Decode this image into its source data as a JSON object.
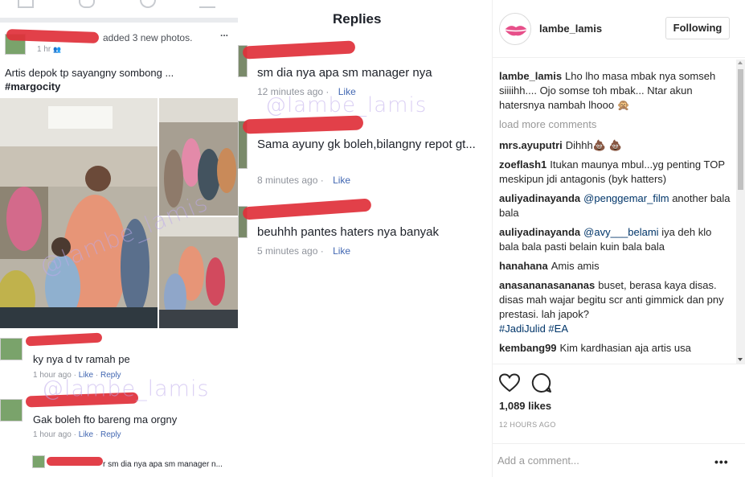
{
  "left": {
    "post_header": "added 3 new photos.",
    "post_meta": "1 hr",
    "post_text": "Artis depok tp sayangny sombong ...",
    "post_hashtag": "#margocity",
    "more_glyph": "...",
    "watermark": "@lambe_lamis",
    "comments": [
      {
        "text": "ky nya d tv ramah pe",
        "time": "1 hour ago",
        "like": "Like",
        "reply": "Reply"
      },
      {
        "text": "Gak boleh fto bareng ma orgny",
        "time": "1 hour ago",
        "like": "Like",
        "reply": "Reply"
      },
      {
        "text": "r sm dia nya apa sm manager n..."
      }
    ]
  },
  "middle": {
    "title": "Replies",
    "watermark": "@lambe_lamis",
    "replies": [
      {
        "text": "sm dia nya apa sm manager nya",
        "time": "12 minutes ago",
        "like": "Like"
      },
      {
        "text": "Sama ayuny gk boleh,bilangny repot gt...",
        "time": "8 minutes ago",
        "like": "Like"
      },
      {
        "text": "beuhhh pantes haters nya banyak",
        "time": "5 minutes ago",
        "like": "Like"
      }
    ]
  },
  "instagram": {
    "username": "lambe_lamis",
    "follow_label": "Following",
    "caption_user": "lambe_lamis",
    "caption": "Lho lho masa mbak nya somseh siiiihh.... Ojo somse toh mbak... Ntar akun hatersnya nambah lhooo 🙊",
    "load_more": "load more comments",
    "comments": [
      {
        "user": "mrs.ayuputri",
        "text": "Dihhh💩 💩"
      },
      {
        "user": "zoeflash1",
        "text": "Itukan maunya mbul...yg penting TOP meskipun jdi antagonis (byk hatters)"
      },
      {
        "user": "auliyadinayanda",
        "mention": "@penggemar_film",
        "text": "another bala bala"
      },
      {
        "user": "auliyadinayanda",
        "mention": "@avy___belami",
        "text": "iya deh klo bala bala pasti belain kuin bala bala"
      },
      {
        "user": "hanahana",
        "text": "Amis amis"
      },
      {
        "user": "anasananasananas",
        "text": "buset, berasa kaya disas. disas mah wajar begitu scr anti gimmick dan pny prestasi. lah japok?",
        "tags": "#JadiJulid #EA"
      },
      {
        "user": "kembang99",
        "text": "Kim kardhasian aja artis usa"
      }
    ],
    "likes": "1,089 likes",
    "time": "12 HOURS AGO",
    "comment_placeholder": "Add a comment...",
    "options_glyph": "•••",
    "colors": {
      "link": "#003569",
      "muted": "#999999",
      "border": "#efefef",
      "text": "#262626"
    }
  }
}
